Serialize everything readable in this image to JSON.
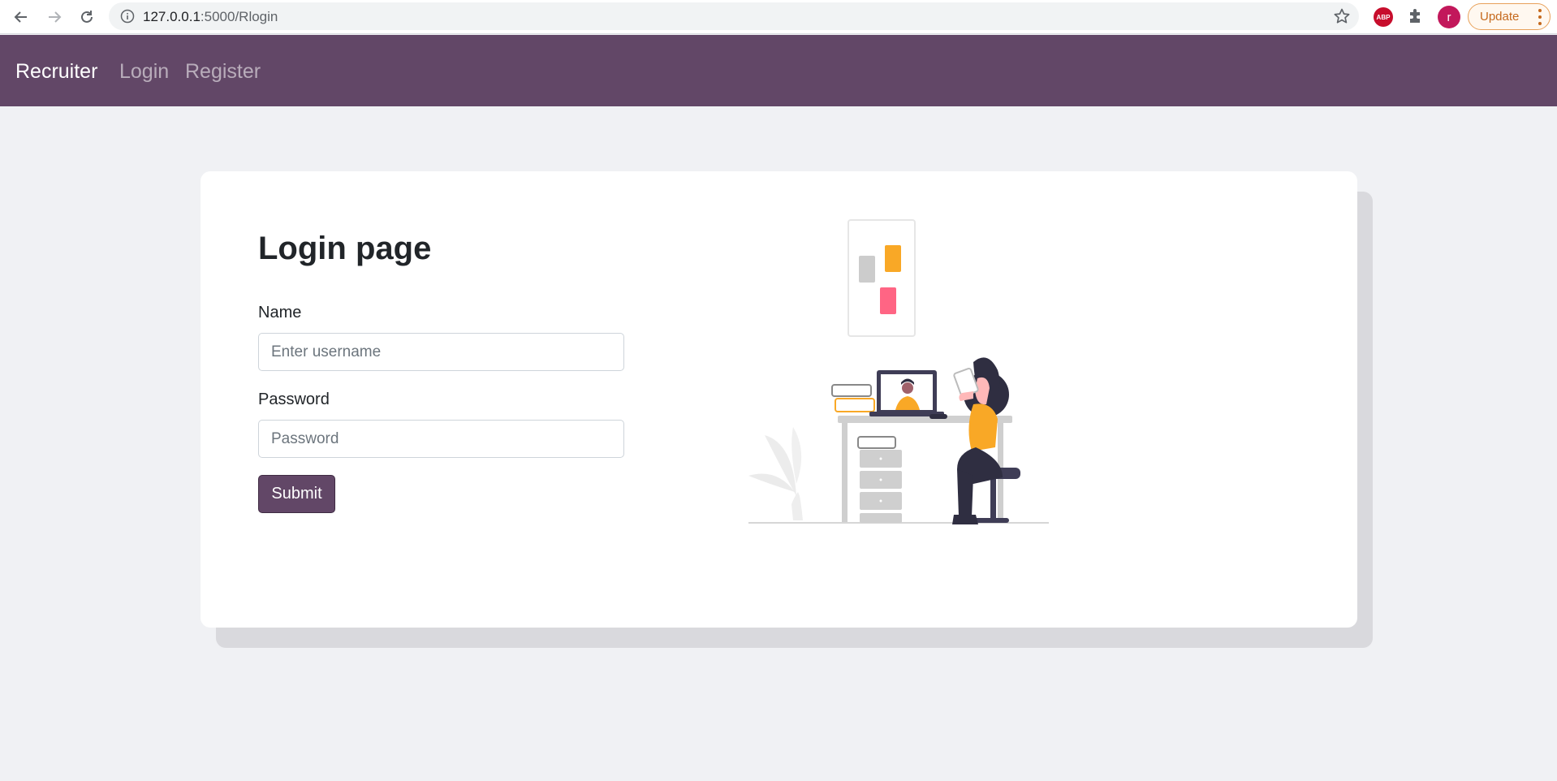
{
  "browser": {
    "url_host": "127.0.0.1",
    "url_path": ":5000/Rlogin",
    "extension_abp_label": "ABP",
    "profile_initial": "r",
    "update_label": "Update",
    "icons": [
      "back-arrow-icon",
      "forward-arrow-icon",
      "reload-icon",
      "info-icon",
      "star-icon",
      "adblock-plus-icon",
      "puzzle-icon",
      "kebab-menu-icon"
    ]
  },
  "navbar": {
    "brand": "Recruiter",
    "links": [
      {
        "label": "Login"
      },
      {
        "label": "Register"
      }
    ],
    "background_color": "#624767"
  },
  "login": {
    "title": "Login page",
    "name_label": "Name",
    "name_placeholder": "Enter username",
    "password_label": "Password",
    "password_placeholder": "Password",
    "submit_label": "Submit"
  },
  "colors": {
    "accent": "#624767",
    "page_background": "#f0f1f4",
    "illustration_yellow": "#f9a826",
    "illustration_pink": "#ff6584"
  }
}
